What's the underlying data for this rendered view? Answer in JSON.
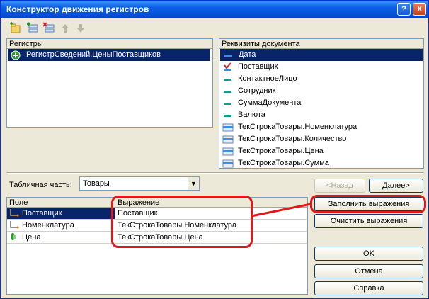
{
  "window": {
    "title": "Конструктор движения регистров",
    "help_glyph": "?",
    "close_glyph": "X"
  },
  "toolbar": {
    "icons": [
      "add-register-icon",
      "add-row-icon",
      "delete-icon",
      "move-up-icon",
      "move-down-icon"
    ]
  },
  "registers": {
    "header": "Регистры",
    "items": [
      {
        "label": "РегистрСведений.ЦеныПоставщиков",
        "selected": true
      }
    ]
  },
  "doc_attributes": {
    "header": "Реквизиты документа",
    "items": [
      {
        "label": "Дата",
        "icon": "attribute-icon",
        "selected": true
      },
      {
        "label": "Поставщик",
        "icon": "checked-attribute-icon"
      },
      {
        "label": "КонтактноеЛицо",
        "icon": "attribute-icon"
      },
      {
        "label": "Сотрудник",
        "icon": "attribute-icon"
      },
      {
        "label": "СуммаДокумента",
        "icon": "attribute-icon"
      },
      {
        "label": "Валюта",
        "icon": "attribute-icon"
      },
      {
        "label": "ТекСтрокаТовары.Номенклатура",
        "icon": "table-attribute-icon"
      },
      {
        "label": "ТекСтрокаТовары.Количество",
        "icon": "table-attribute-icon"
      },
      {
        "label": "ТекСтрокаТовары.Цена",
        "icon": "table-attribute-icon"
      },
      {
        "label": "ТекСтрокаТовары.Сумма",
        "icon": "table-attribute-icon"
      }
    ]
  },
  "tabular": {
    "label": "Табличная часть:",
    "value": "Товары"
  },
  "nav": {
    "back": "<Назад",
    "next": "Далее>"
  },
  "fields_table": {
    "col_field": "Поле",
    "col_expr": "Выражение",
    "rows": [
      {
        "field": "Поставщик",
        "expr": "Поставщик",
        "selected": true
      },
      {
        "field": "Номенклатура",
        "expr": "ТекСтрокаТовары.Номенклатура"
      },
      {
        "field": "Цена",
        "expr": "ТекСтрокаТовары.Цена"
      }
    ]
  },
  "buttons": {
    "fill": "Заполнить выражения",
    "clear": "Очистить выражения",
    "ok": "OK",
    "cancel": "Отмена",
    "help": "Справка"
  },
  "colors": {
    "selection": "#0a246a",
    "highlight": "#e01818",
    "titlebar": "#0a5fe6"
  }
}
